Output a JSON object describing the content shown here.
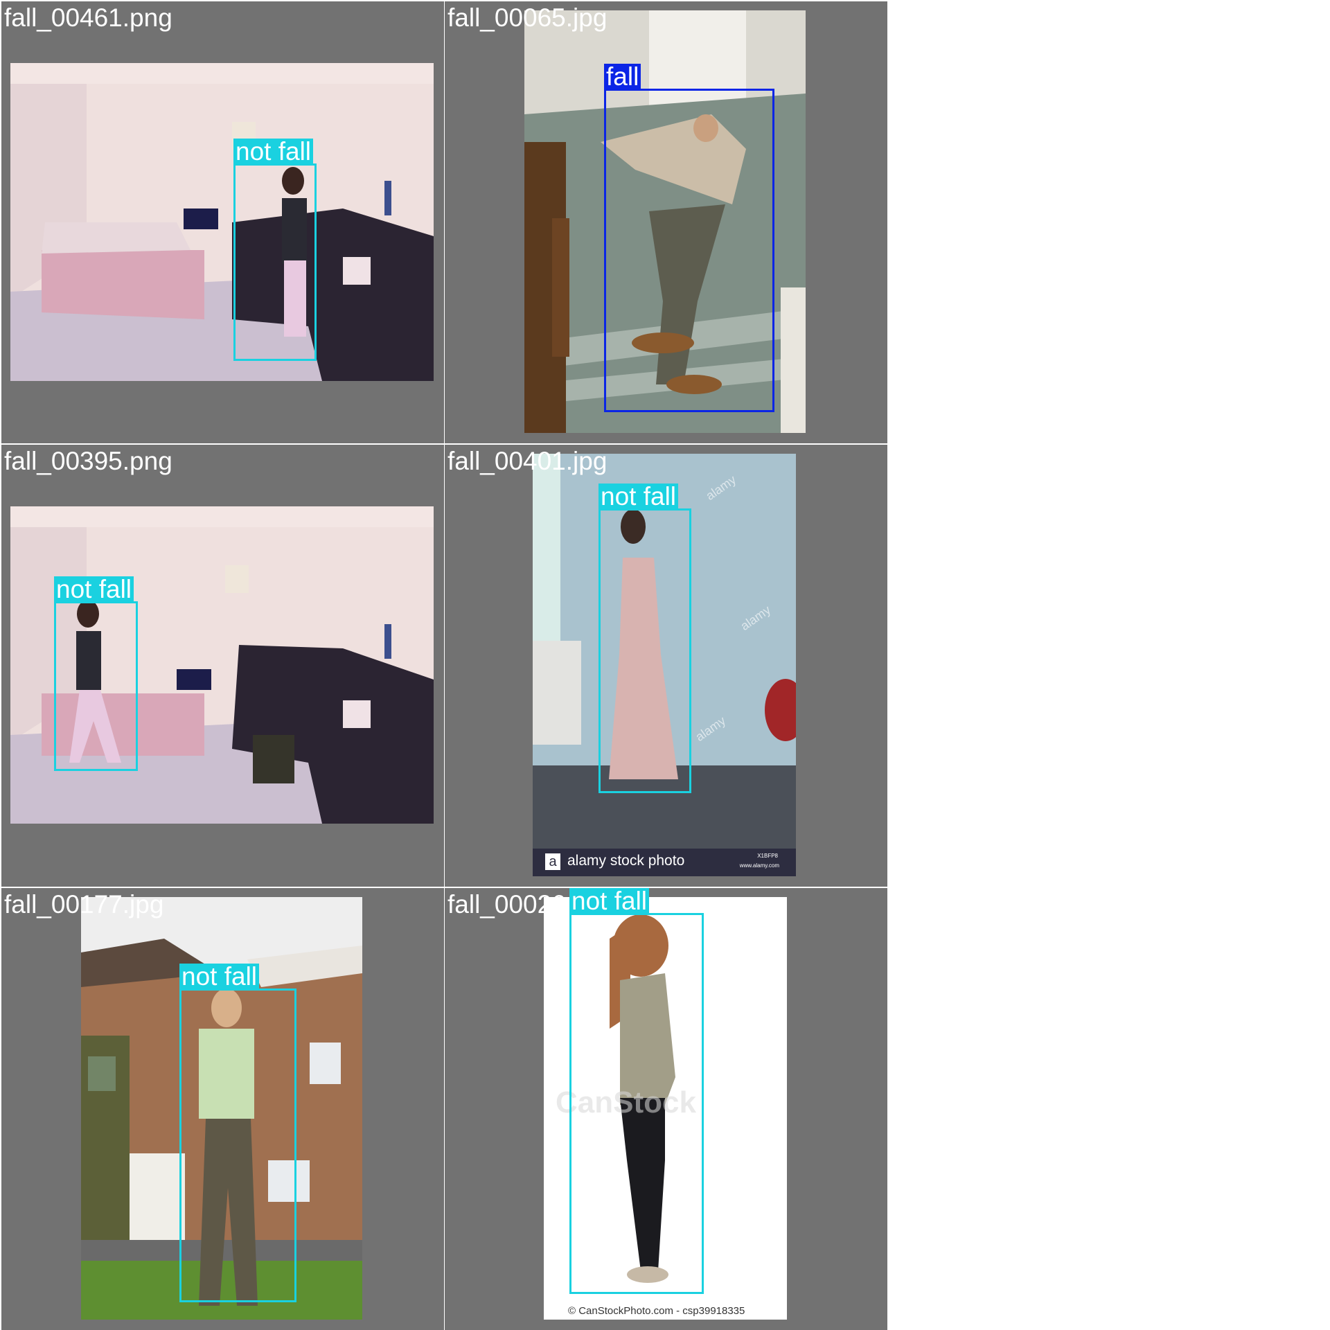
{
  "tiles": [
    {
      "filename": "fall_00461.png",
      "detections": [
        {
          "label": "not fall",
          "class": "not-fall"
        }
      ]
    },
    {
      "filename": "fall_00065.jpg",
      "detections": [
        {
          "label": "fall",
          "class": "fall"
        }
      ]
    },
    {
      "filename": "fall_00395.png",
      "detections": [
        {
          "label": "not fall",
          "class": "not-fall"
        }
      ]
    },
    {
      "filename": "fall_00401.jpg",
      "detections": [
        {
          "label": "not fall",
          "class": "not-fall"
        }
      ],
      "watermark": {
        "brand": "alamy stock photo",
        "logo": "a",
        "code": "X1BFP8",
        "url": "www.alamy.com",
        "overlay": "alamy"
      }
    },
    {
      "filename": "fall_00177.jpg",
      "detections": [
        {
          "label": "not fall",
          "class": "not-fall"
        }
      ]
    },
    {
      "filename": "fall_00026.jpg",
      "detections": [
        {
          "label": "not fall",
          "class": "not-fall"
        }
      ],
      "watermark": {
        "overlay": "CanStock",
        "credit": "© CanStockPhoto.com - csp39918335"
      }
    }
  ],
  "colors": {
    "tile_bg": "#727272",
    "not_fall": "#1ad1e0",
    "fall": "#0b25e6",
    "label_text": "#ffffff"
  }
}
